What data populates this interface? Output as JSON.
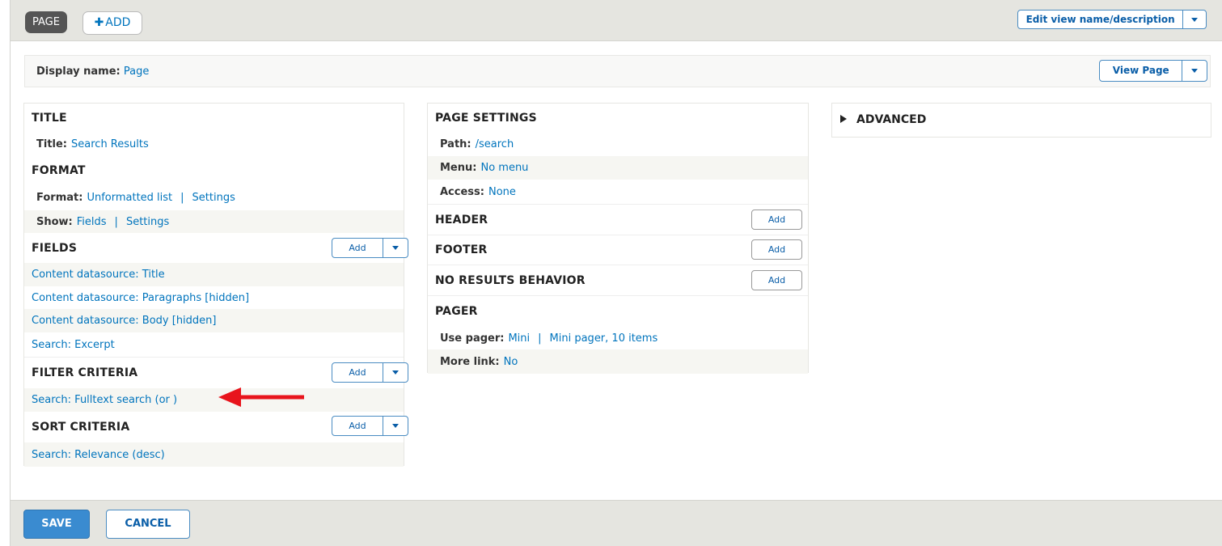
{
  "topbar": {
    "tab_page": "PAGE",
    "tab_add": "ADD",
    "edit_view_label": "Edit view name/description"
  },
  "display": {
    "label": "Display name:",
    "value": "Page",
    "view_page_label": "View Page"
  },
  "col1": {
    "title_header": "TITLE",
    "title_label": "Title:",
    "title_value": "Search Results",
    "format_header": "FORMAT",
    "format_label": "Format:",
    "format_value": "Unformatted list",
    "format_settings": "Settings",
    "show_label": "Show:",
    "show_value": "Fields",
    "show_settings": "Settings",
    "fields_header": "FIELDS",
    "fields_add": "Add",
    "fields": [
      "Content datasource: Title",
      "Content datasource: Paragraphs [hidden]",
      "Content datasource: Body [hidden]",
      "Search: Excerpt"
    ],
    "filter_header": "FILTER CRITERIA",
    "filter_add": "Add",
    "filter_item": "Search: Fulltext search (or )",
    "sort_header": "SORT CRITERIA",
    "sort_add": "Add",
    "sort_item": "Search: Relevance (desc)"
  },
  "col2": {
    "page_settings_header": "PAGE SETTINGS",
    "path_label": "Path:",
    "path_value": "/search",
    "menu_label": "Menu:",
    "menu_value": "No menu",
    "access_label": "Access:",
    "access_value": "None",
    "header_header": "HEADER",
    "header_add": "Add",
    "footer_header": "FOOTER",
    "footer_add": "Add",
    "noresults_header": "NO RESULTS BEHAVIOR",
    "noresults_add": "Add",
    "pager_header": "PAGER",
    "pager_label": "Use pager:",
    "pager_value": "Mini",
    "pager_detail": "Mini pager, 10 items",
    "more_label": "More link:",
    "more_value": "No"
  },
  "col3": {
    "advanced_header": "ADVANCED"
  },
  "footer": {
    "save_label": "SAVE",
    "cancel_label": "CANCEL"
  },
  "colors": {
    "link": "#0074bd",
    "annotation_arrow": "#e8141c",
    "save_bg": "#3a8bd0"
  }
}
